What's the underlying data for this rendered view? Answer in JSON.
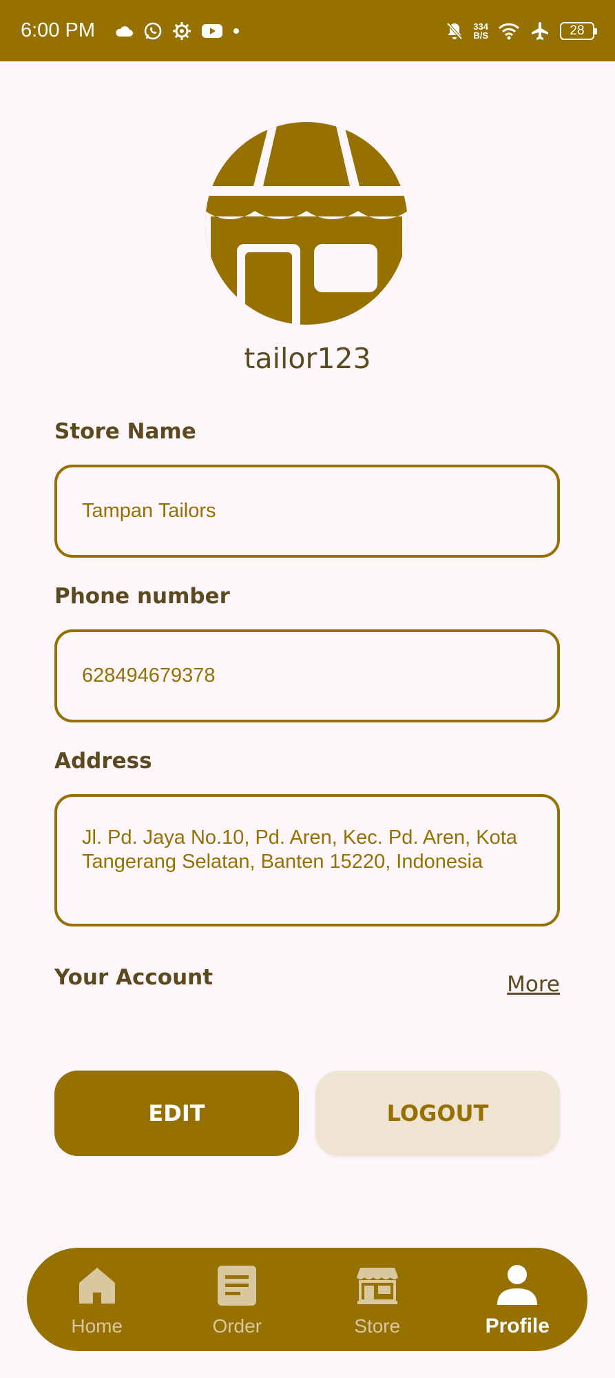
{
  "status_bar": {
    "time": "6:00 PM",
    "net_speed_value": "334",
    "net_speed_unit": "B/S",
    "battery": "28",
    "icons": [
      "cloud-icon",
      "whatsapp-icon",
      "gear-icon",
      "youtube-icon",
      "dot-icon",
      "bell-off-icon",
      "wifi-icon",
      "airplane-icon",
      "battery-icon"
    ]
  },
  "profile": {
    "username": "tailor123"
  },
  "fields": {
    "store_name": {
      "label": "Store Name",
      "value": "Tampan Tailors"
    },
    "phone": {
      "label": "Phone number",
      "value": "628494679378"
    },
    "address": {
      "label": "Address",
      "value": "Jl. Pd. Jaya No.10, Pd. Aren, Kec. Pd. Aren, Kota Tangerang Selatan, Banten 15220, Indonesia"
    }
  },
  "account": {
    "label": "Your Account",
    "more": "More"
  },
  "buttons": {
    "edit": "EDIT",
    "logout": "LOGOUT"
  },
  "nav": {
    "home": "Home",
    "order": "Order",
    "store": "Store",
    "profile": "Profile",
    "active": "profile"
  },
  "colors": {
    "primary": "#967000",
    "background": "#fdf7fc",
    "text_dark": "#5c4a1e",
    "logout_bg": "#efe4d2"
  }
}
